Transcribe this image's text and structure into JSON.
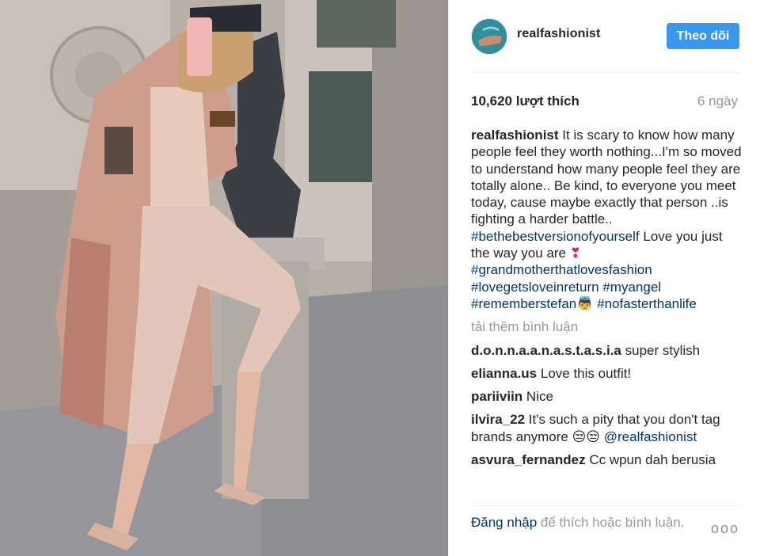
{
  "post": {
    "username": "realfashionist",
    "follow_label": "Theo dõi",
    "likes": "10,620 lượt thích",
    "time_ago": "6 ngày"
  },
  "caption": {
    "username": "realfashionist",
    "text_1": "It is scary to know how many people feel they worth nothing...I'm so moved to understand how many people feel they are totally alone.. Be kind, to everyone you meet today, cause maybe exactly that person ..is fighting a harder battle..",
    "tag_1": "#bethebestversionofyourself",
    "text_2": "Love you just the way you are",
    "emoji_1": "❣",
    "tag_2": "#grandmotherthatlovesfashion",
    "tag_3": "#lovegetsloveinreturn",
    "tag_4": "#myangel",
    "tag_5": "#rememberstefan",
    "emoji_2": "👼",
    "tag_6": "#nofasterthanlife"
  },
  "load_more": "tải thêm bình luận",
  "comments": [
    {
      "username": "d.o.n.n.a.a.n.a.s.t.a.s.i.a",
      "text": "super stylish"
    },
    {
      "username": "elianna.us",
      "text": "Love this outfit!"
    },
    {
      "username": "pariiviin",
      "text": "Nice"
    },
    {
      "username": "ilvira_22",
      "text": "It's such a pity that you don't tag brands anymore 😒😒",
      "mention": "@realfashionist"
    },
    {
      "username": "asvura_fernandez",
      "text": "Cc wpun dah berusia"
    }
  ],
  "footer": {
    "login_link": "Đăng nhập",
    "login_text": "để thích hoặc bình luận.",
    "more_label": "ooo"
  },
  "colors": {
    "follow_button": "#3897f0",
    "hashtag": "#003569",
    "muted": "#999999"
  }
}
